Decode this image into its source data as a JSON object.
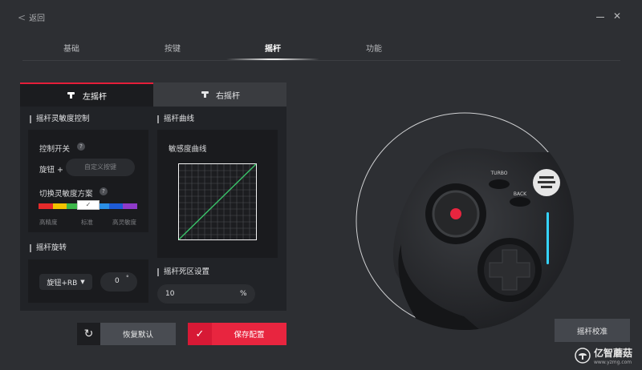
{
  "header": {
    "back_label": "返回",
    "back_chevron": "<",
    "close_glyph": "✕"
  },
  "tabs": [
    {
      "label": "基础"
    },
    {
      "label": "按键"
    },
    {
      "label": "摇杆",
      "active": true
    },
    {
      "label": "功能"
    }
  ],
  "stick_tabs": {
    "left": "左摇杆",
    "right": "右摇杆",
    "active": "left"
  },
  "sensitivity": {
    "title": "摇杆灵敏度控制",
    "switch_label": "控制开关",
    "knob_label": "旋钮 +",
    "custom_key_placeholder": "自定义按键",
    "scheme_label": "切换灵敏度方案",
    "help_glyph": "?",
    "scheme_colors": [
      "#e52a2a",
      "#f2c200",
      "#3db84a",
      "#ffffff",
      "#2b8fe6",
      "#1e5bd6",
      "#8e3ac9"
    ],
    "selected_index": 3,
    "check_glyph": "✓",
    "scale_labels": [
      "高精度",
      "标准",
      "高灵敏度"
    ]
  },
  "rotation": {
    "title": "摇杆旋转",
    "mode_value": "旋钮+RB",
    "dropdown_arrow": "▼",
    "angle_value": "0",
    "angle_unit": "°"
  },
  "curve": {
    "title": "摇杆曲线",
    "sub_title": "敏感度曲线"
  },
  "deadzone": {
    "title": "摇杆死区设置",
    "value": "10",
    "unit": "%"
  },
  "buttons": {
    "reset_label": "恢复默认",
    "reset_icon": "↻",
    "save_label": "保存配置",
    "save_icon": "✓",
    "calibrate_label": "摇杆校准"
  },
  "controller": {
    "turbo_label": "TURBO",
    "back_label": "BACK"
  },
  "watermark": {
    "text": "亿智蘑菇",
    "url": "www.yzmg.com"
  },
  "colors": {
    "accent_red": "#e8253f",
    "panel": "#212327",
    "curve_line": "#3ac46a",
    "light_strip": "#35d4ff"
  }
}
